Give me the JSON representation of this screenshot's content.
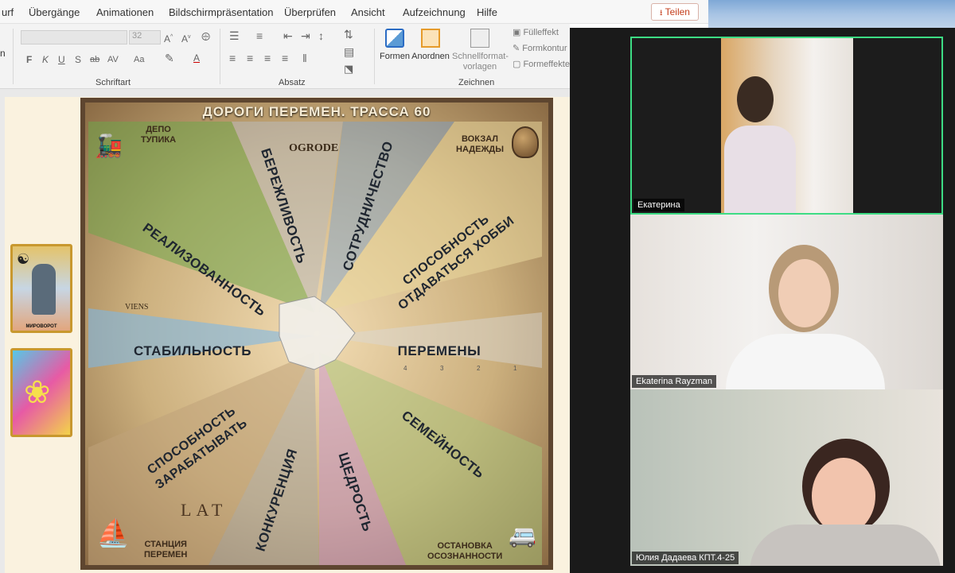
{
  "ribbon": {
    "tabs": [
      "urf",
      "Übergänge",
      "Animationen",
      "Bildschirmpräsentation",
      "Überprüfen",
      "Ansicht",
      "Aufzeichnung",
      "Hilfe"
    ],
    "share_label": "Teilen",
    "left_cut": "n",
    "font_size_value": "32",
    "groups": {
      "font": "Schriftart",
      "paragraph": "Absatz",
      "drawing": "Zeichnen"
    },
    "font_buttons": [
      "F",
      "K",
      "U",
      "S",
      "ab",
      "AV",
      "Aa"
    ],
    "drawing_tools": {
      "shapes": "Formen",
      "arrange": "Anordnen",
      "quick_styles": "Schnellformat-\nvorlagen",
      "fill": "Fülleffekt",
      "outline": "Formkontur",
      "effects": "Formeffekte"
    }
  },
  "slide": {
    "title": "ДОРОГИ ПЕРЕМЕН. ТРАССА 60",
    "corners": {
      "top_left": "ДЕПО\nТУПИКА",
      "top_right": "ВОКЗАЛ\nНАДЕЖДЫ",
      "bottom_left": "СТАНЦИЯ\nПЕРЕМЕН",
      "bottom_right": "ОСТАНОВКА\nОСОЗНАННОСТИ"
    },
    "map_words": [
      "OGRODE",
      "VIENS",
      "LAT"
    ],
    "roads": [
      "БЕРЕЖЛИВОСТЬ",
      "СОТРУДНИЧЕСТВО",
      "СПОСОБНОСТЬ\nОТДАВАТЬСЯ ХОББИ",
      "РЕАЛИЗОВАННОСТЬ",
      "СТАБИЛЬНОСТЬ",
      "ПЕРЕМЕНЫ",
      "СПОСОБНОСТЬ\nЗАРАБАТЫВАТЬ",
      "КОНКУРЕНЦИЯ",
      "ЩЕДРОСТЬ",
      "СЕМЕЙНОСТЬ"
    ],
    "peremeny_numbers": [
      "4",
      "3",
      "2",
      "1"
    ],
    "left_card_caption": "МИРОВОРОТ"
  },
  "participants": [
    {
      "name": "Екатерина",
      "active": true
    },
    {
      "name": "Ekaterina Rayzman",
      "active": false
    },
    {
      "name": "Юлия Дадаева КПТ.4-25",
      "active": false
    }
  ],
  "colors": {
    "active_speaker_border": "#3ddc84",
    "share_text": "#c43e1c",
    "board_frame": "#5e4630"
  }
}
